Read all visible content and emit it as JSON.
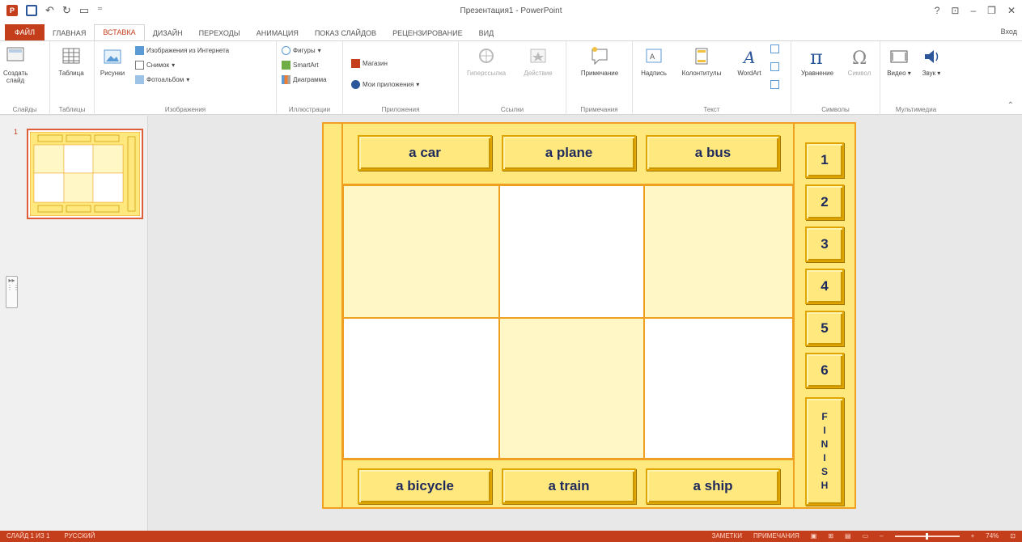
{
  "titlebar": {
    "title": "Презентация1 - PowerPoint",
    "help": "?",
    "restore_ribbon": "⊡",
    "minimize": "–",
    "maximize": "❐",
    "close": "✕"
  },
  "tabs": {
    "file": "ФАЙЛ",
    "home": "ГЛАВНАЯ",
    "insert": "ВСТАВКА",
    "design": "ДИЗАЙН",
    "transitions": "ПЕРЕХОДЫ",
    "animations": "АНИМАЦИЯ",
    "slideshow": "ПОКАЗ СЛАЙДОВ",
    "review": "РЕЦЕНЗИРОВАНИЕ",
    "view": "ВИД",
    "signin": "Вход"
  },
  "ribbon": {
    "slides": {
      "new_slide": "Создать слайд",
      "label": "Слайды"
    },
    "tables": {
      "table": "Таблица",
      "label": "Таблицы"
    },
    "images": {
      "pictures": "Рисунки",
      "online": "Изображения из Интернета",
      "screenshot": "Снимок",
      "album": "Фотоальбом",
      "label": "Изображения"
    },
    "illustrations": {
      "shapes": "Фигуры",
      "smartart": "SmartArt",
      "chart": "Диаграмма",
      "label": "Иллюстрации"
    },
    "apps": {
      "store": "Магазин",
      "my_apps": "Мои приложения",
      "label": "Приложения"
    },
    "links": {
      "hyperlink": "Гиперссылка",
      "action": "Действие",
      "label": "Ссылки"
    },
    "comments": {
      "comment": "Примечание",
      "label": "Примечания"
    },
    "text": {
      "textbox": "Надпись",
      "header_footer": "Колонтитулы",
      "wordart": "WordArt",
      "label": "Текст"
    },
    "symbols": {
      "equation": "Уравнение",
      "symbol": "Символ",
      "label": "Символы"
    },
    "media": {
      "video": "Видео",
      "audio": "Звук",
      "label": "Мультимедиа"
    }
  },
  "thumbnail": {
    "number": "1"
  },
  "slide": {
    "top_words": [
      "a car",
      "a plane",
      "a bus"
    ],
    "bottom_words": [
      "a bicycle",
      "a train",
      "a ship"
    ],
    "numbers": [
      "1",
      "2",
      "3",
      "4",
      "5",
      "6"
    ],
    "finish": [
      "F",
      "I",
      "N",
      "I",
      "S",
      "H"
    ]
  },
  "status": {
    "slide_info": "СЛАЙД 1 ИЗ 1",
    "language": "РУССКИЙ",
    "notes": "ЗАМЕТКИ",
    "comments": "ПРИМЕЧАНИЯ",
    "zoom": "74%"
  },
  "colors": {
    "accent": "#c43e1c",
    "slide_yellow": "#ffe97f",
    "slide_border": "#f0a020",
    "text_navy": "#1f2a5c"
  }
}
